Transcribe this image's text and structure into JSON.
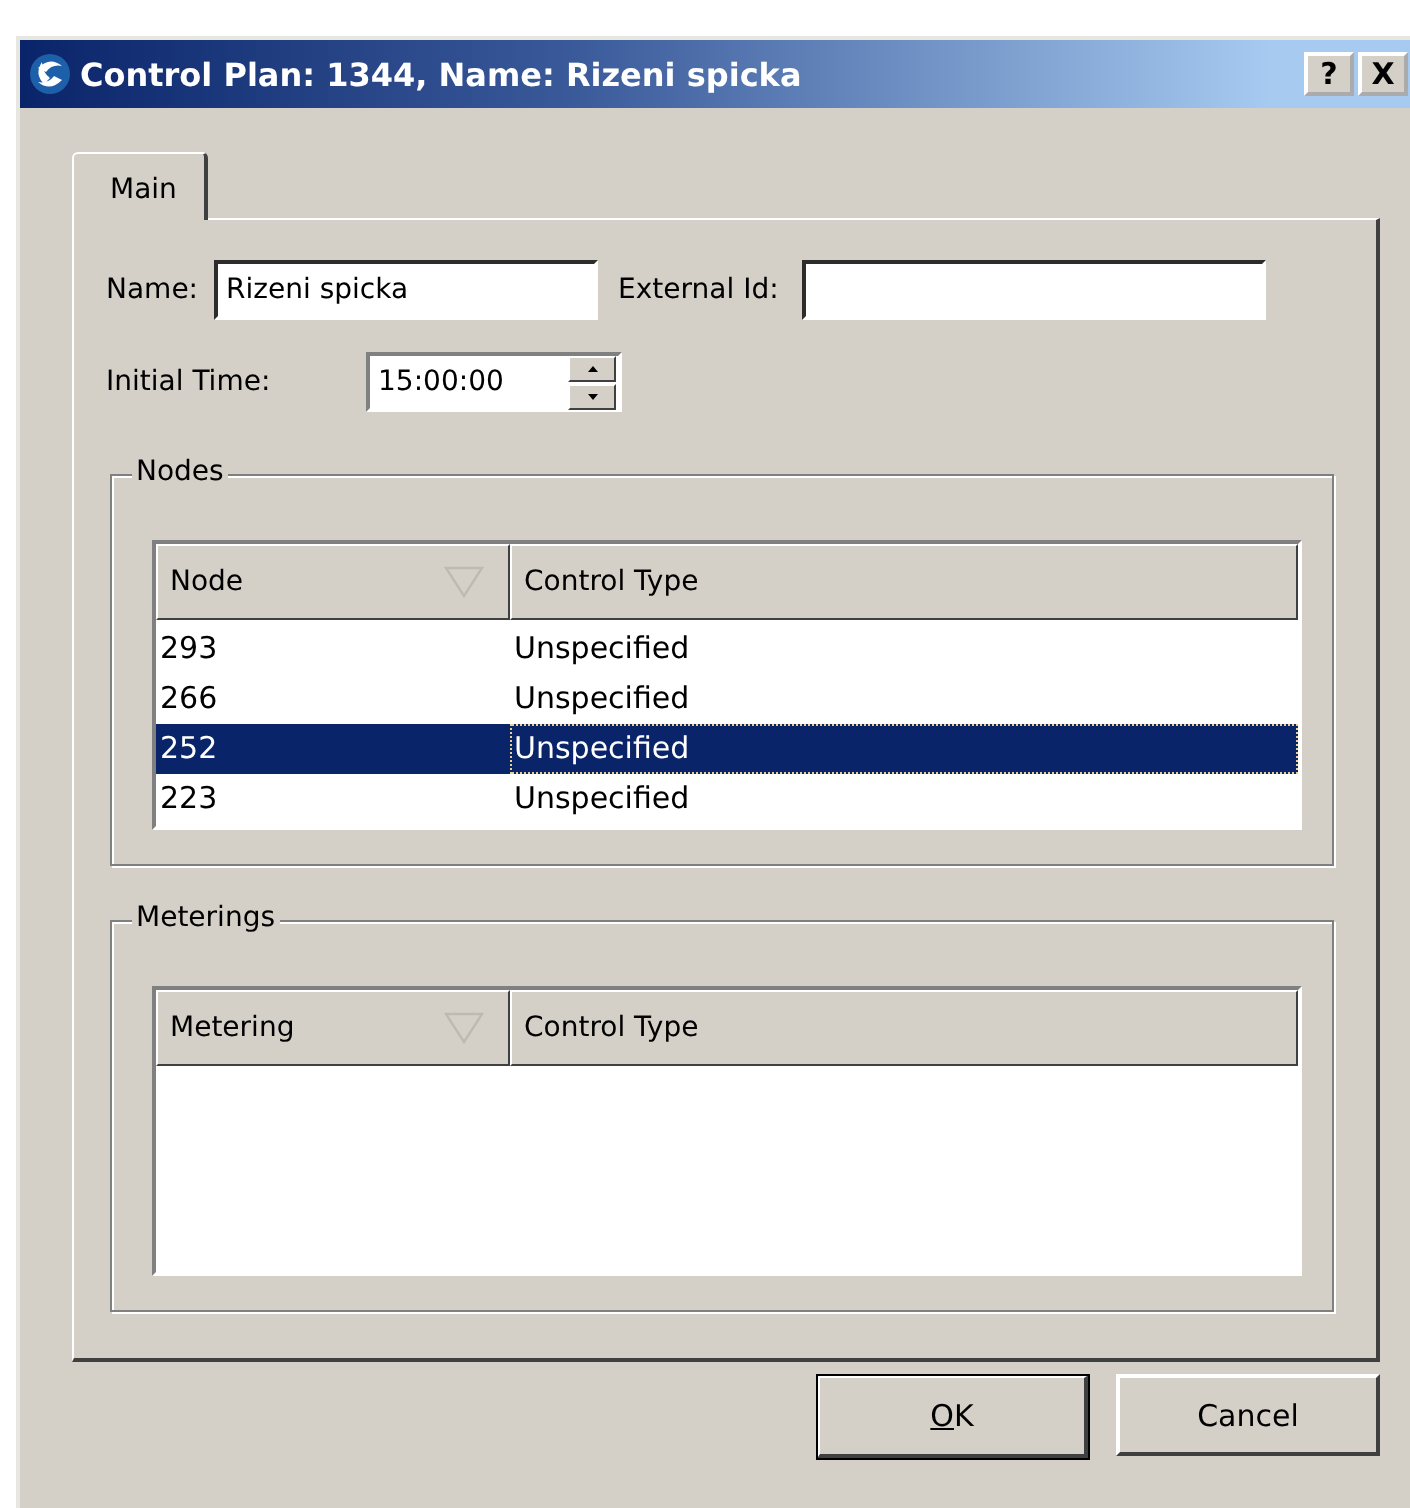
{
  "window": {
    "title": "Control Plan: 1344, Name: Rizeni spicka",
    "buttons": [
      {
        "label": "?"
      },
      {
        "label": "X"
      }
    ]
  },
  "tabs": [
    {
      "label": "Main",
      "selected": true
    }
  ],
  "fields": {
    "name": {
      "label": "Name:",
      "value": "Rizeni spicka"
    },
    "external_id": {
      "label": "External Id:"
    },
    "initial_time": {
      "label": "Initial Time:",
      "value": "15:00:00"
    }
  },
  "groups": [
    {
      "title": "Nodes",
      "columns": [
        {
          "label": "Node",
          "sorted": true
        },
        {
          "label": "Control Type",
          "sorted": false
        }
      ],
      "rows": [
        {
          "cells": [
            "293",
            "Unspecified"
          ],
          "selected": false
        },
        {
          "cells": [
            "266",
            "Unspecified"
          ],
          "selected": false
        },
        {
          "cells": [
            "252",
            "Unspecified"
          ],
          "selected": true
        },
        {
          "cells": [
            "223",
            "Unspecified"
          ],
          "selected": false
        }
      ]
    },
    {
      "title": "Meterings",
      "columns": [
        {
          "label": "Metering",
          "sorted": true
        },
        {
          "label": "Control Type",
          "sorted": false
        }
      ]
    }
  ],
  "buttons": [
    {
      "label": "OK",
      "access_key_underlined": true,
      "default": true
    },
    {
      "label": "Cancel",
      "access_key_underlined": false,
      "default": false
    }
  ]
}
